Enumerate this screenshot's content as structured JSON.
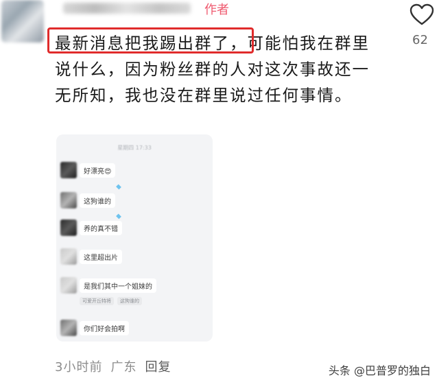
{
  "header": {
    "author_tag": "作者"
  },
  "like": {
    "count": "62",
    "icon": "heart-outline-icon"
  },
  "comment": {
    "highlighted": "最新消息把我踢出群了，",
    "rest": "可能怕我在群里说什么，因为粉丝群的人对这次事故还一无所知，我也没在群里说过任何事情。"
  },
  "chat_screenshot": {
    "time": "星期四 17:33",
    "messages": [
      {
        "text": "好漂亮😍"
      },
      {
        "text": "这狗谁的"
      },
      {
        "text": "养的真不错"
      },
      {
        "text": "这里超出片"
      },
      {
        "text": "是我们其中一个姐妹的"
      },
      {
        "text": "你们好会拍啊"
      }
    ],
    "sub_bubbles": [
      "可爱开丘特将",
      "这狗谁的"
    ]
  },
  "footer": {
    "time": "3小时前",
    "location": "广东",
    "reply": "回复",
    "watermark": "头条 @巴普罗的独白"
  },
  "colors": {
    "author": "#ef5a6f",
    "highlight": "#e02b2b",
    "muted": "#8c8c8c"
  }
}
